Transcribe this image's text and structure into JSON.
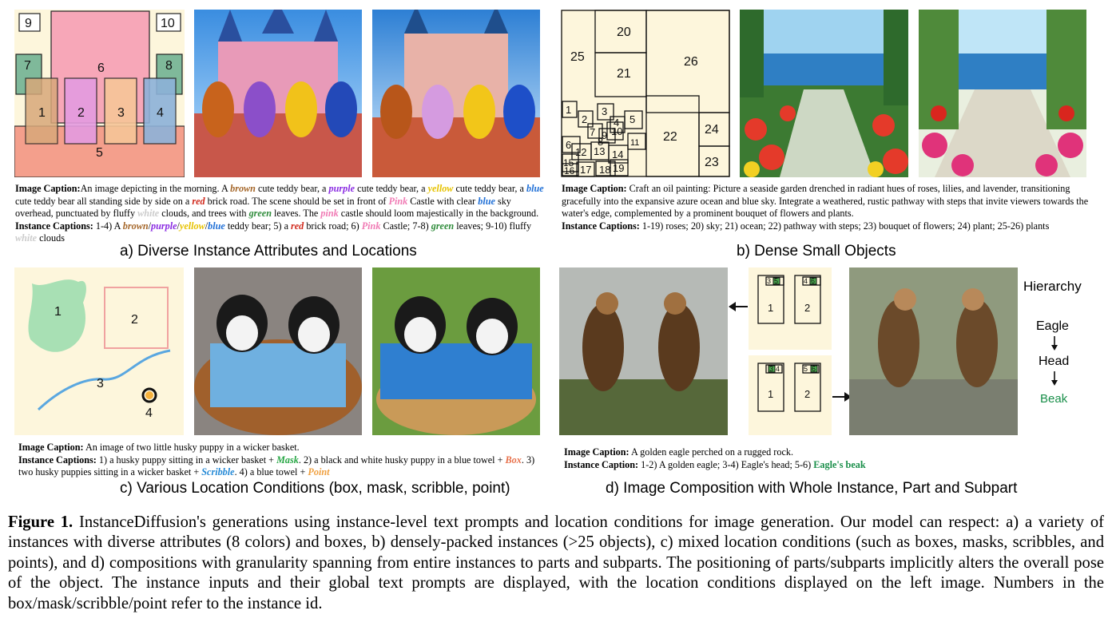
{
  "panel_a": {
    "layout_labels": [
      "9",
      "10",
      "7",
      "8",
      "6",
      "1",
      "2",
      "3",
      "4",
      "5"
    ],
    "caption_head": "Image Caption:",
    "caption_parts": [
      "An image depicting in the morning. A ",
      "brown",
      " cute teddy bear, a ",
      "purple",
      " cute teddy bear, a ",
      "yellow",
      " cute teddy bear, a ",
      "blue",
      " cute teddy bear all standing side by side on a ",
      "red",
      " brick road. The scene should be set in front of ",
      "Pink",
      " Castle with clear ",
      "blue",
      " sky overhead, punctuated by fluffy ",
      "white",
      " clouds, and trees with ",
      "green",
      " leaves. The ",
      "pink",
      " castle should loom majestically in the background. "
    ],
    "inst_head": "Instance Captions:",
    "inst_parts": [
      " 1-4) A ",
      "brown",
      "/",
      "purple",
      "/",
      "yellow",
      "/",
      "blue",
      " teddy bear; 5) a ",
      "red",
      " brick road; 6) ",
      "Pink",
      " Castle; 7-8) ",
      "green",
      " leaves; 9-10) fluffy ",
      "white",
      " clouds"
    ],
    "subtitle": "a)  Diverse Instance Attributes and Locations"
  },
  "panel_b": {
    "layout_labels": [
      "20",
      "25",
      "21",
      "26",
      "1",
      "3",
      "2",
      "4",
      "5",
      "9",
      "10",
      "7",
      "8",
      "11",
      "22",
      "24",
      "6",
      "12",
      "13",
      "14",
      "15",
      "16",
      "17",
      "18",
      "19",
      "23"
    ],
    "caption_head": "Image Caption:",
    "caption_text": " Craft an oil painting: Picture a seaside garden drenched in radiant hues of roses, lilies, and lavender, transitioning gracefully into the expansive azure ocean and blue sky. Integrate a weathered, rustic pathway with steps that invite viewers towards the water's edge, complemented by a prominent bouquet of flowers and plants.",
    "inst_head": "Instance Captions:",
    "inst_text": " 1-19) roses; 20) sky; 21) ocean; 22) pathway with steps; 23) bouquet of flowers; 24) plant; 25-26) plants",
    "subtitle": "b)  Dense Small Objects"
  },
  "panel_c": {
    "layout_labels": [
      "1",
      "2",
      "3",
      "4"
    ],
    "caption_head": "Image Caption:",
    "caption_text": " An image of two little husky puppy in a wicker basket.",
    "inst_head": "Instance Captions:",
    "inst_parts": [
      " 1) a husky puppy sitting in a wicker basket + ",
      "Mask",
      ". 2) a black and white husky puppy in a blue towel + ",
      "Box",
      ". 3) two husky puppies sitting in a wicker basket + ",
      "Scribble",
      ". 4) a blue towel + ",
      "Point"
    ],
    "subtitle": "c)  Various Location Conditions (box, mask, scribble, point)"
  },
  "panel_d": {
    "layout_labels": [
      "3",
      "5",
      "4",
      "6",
      "1",
      "2",
      "3",
      "4",
      "5",
      "6",
      "1",
      "2"
    ],
    "hierarchy_title": "Hierarchy",
    "hierarchy_items": [
      "Eagle",
      "Head",
      "Beak"
    ],
    "caption_head": "Image Caption:",
    "caption_text": " A golden eagle perched on a rugged rock.",
    "inst_head": "Instance Caption:",
    "inst_text": " 1-2) A golden eagle; 3-4) Eagle's head; 5-6) ",
    "inst_beak": "Eagle's beak",
    "subtitle": "d)  Image Composition with Whole Instance, Part and Subpart"
  },
  "figure_caption": {
    "label": "Figure 1.",
    "text": " InstanceDiffusion's generations using instance-level text prompts and location conditions for image generation. Our model can respect: a) a variety of instances with diverse attributes (8 colors) and boxes, b) densely-packed instances (>25 objects), c) mixed location conditions (such as boxes, masks, scribbles, and points), and d) compositions with granularity spanning from entire instances to parts and subparts. The positioning of parts/subparts implicitly alters the overall pose of the object. The instance inputs and their global text prompts are displayed, with the location conditions displayed on the left image. Numbers in the box/mask/scribble/point refer to the instance id."
  }
}
